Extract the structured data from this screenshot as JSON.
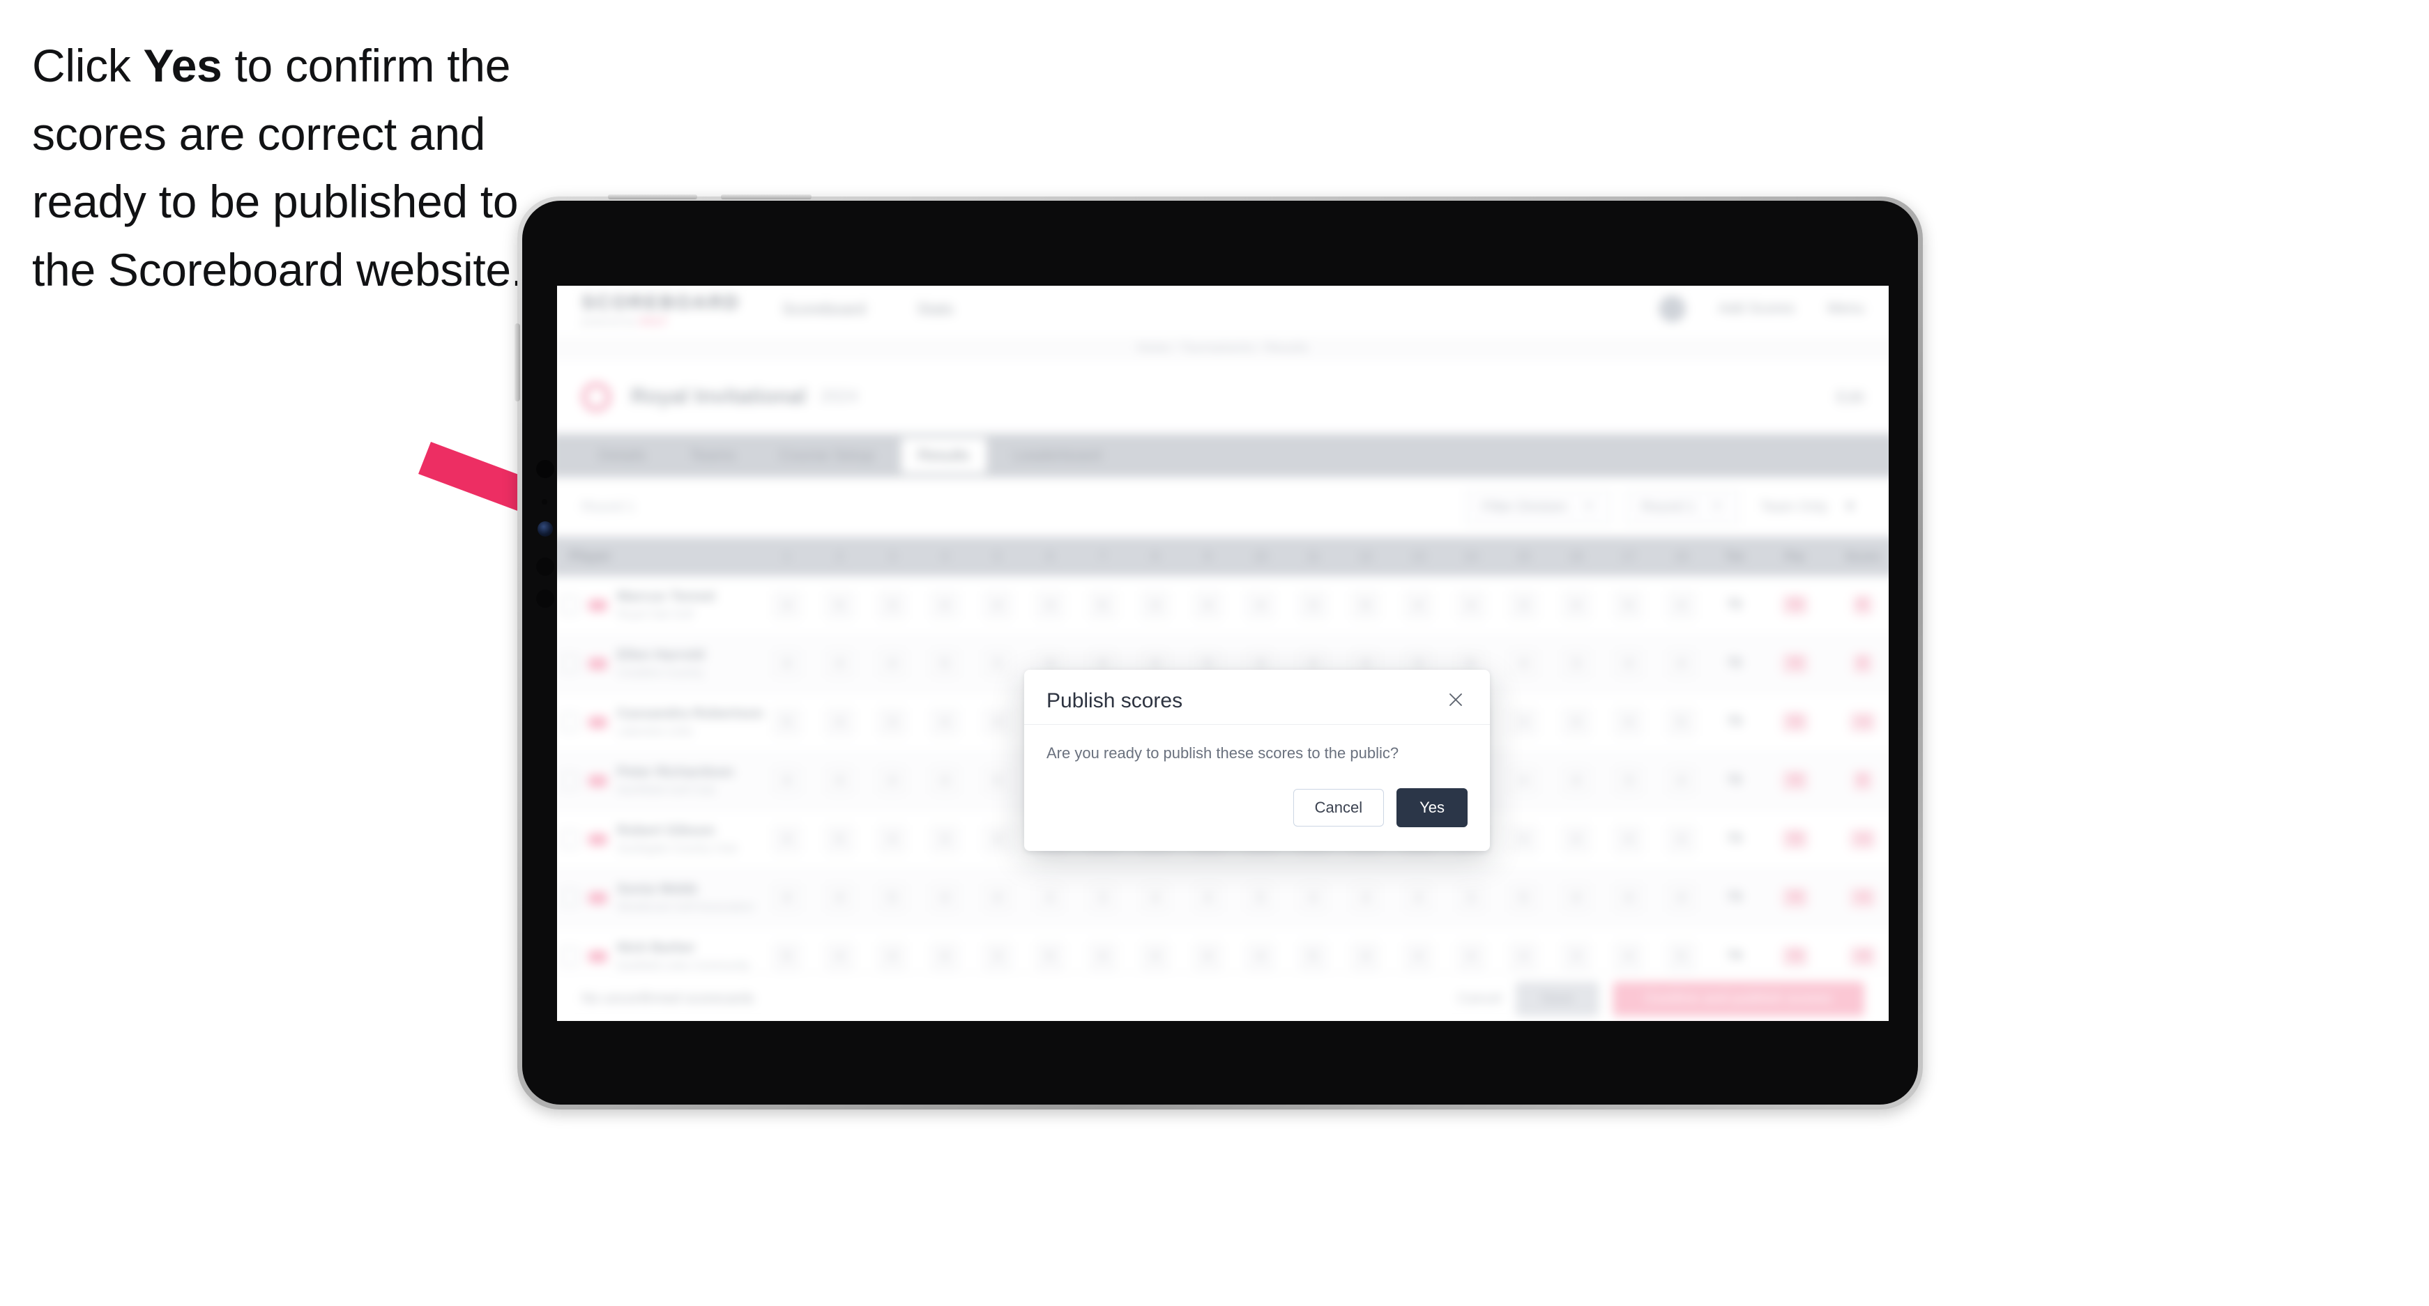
{
  "instruction": {
    "before": "Click ",
    "emphasis": "Yes",
    "after": " to confirm the scores are correct and ready to be published to the Scoreboard website."
  },
  "arrow": {
    "color": "#ED2E63",
    "name": "callout-arrow"
  },
  "device": {
    "type": "tablet",
    "orientation": "landscape",
    "frame_color": "#b9b9b9",
    "bezel_color": "#0b0b0c"
  },
  "app": {
    "topnav": {
      "logo_wordmark": "SCOREBOARD",
      "logo_tagline": "powered by",
      "logo_tagline_accent": "GOLF",
      "items": [
        {
          "label": "Scoreboard"
        },
        {
          "label": "Stats"
        }
      ],
      "right_items": [
        {
          "label": "Add Scores"
        },
        {
          "label": "Menu"
        }
      ]
    },
    "breadcrumb": "Home / Tournaments / Results",
    "title": {
      "heading": "Royal Invitational",
      "subheading": "2024",
      "right_action": "Edit"
    },
    "tabs": [
      {
        "label": "Details",
        "active": false
      },
      {
        "label": "Teams",
        "active": false
      },
      {
        "label": "Course Setup",
        "active": false
      },
      {
        "label": "Results",
        "active": true
      },
      {
        "label": "Leaderboard",
        "active": false
      }
    ],
    "filters": {
      "left_label": "Round 1",
      "controls": [
        {
          "label": "Filter Division",
          "type": "dropdown"
        },
        {
          "label": "Round 1",
          "type": "dropdown"
        },
        {
          "label": "Team Only",
          "type": "toggle"
        }
      ]
    },
    "table": {
      "columns": {
        "player": "Player",
        "holes": [
          "1",
          "2",
          "3",
          "4",
          "5",
          "6",
          "7",
          "8",
          "9",
          "10",
          "11",
          "12",
          "13",
          "14",
          "15",
          "16",
          "17",
          "18"
        ],
        "total": "Tot",
        "par": "Par",
        "score": "Score"
      },
      "rows": [
        {
          "name": "Marcus Tennet",
          "club": "Royal Oak Golf",
          "holes": [
            "4",
            "5",
            "3",
            "4",
            "4",
            "3",
            "5",
            "4",
            "4",
            "4",
            "3",
            "5",
            "4",
            "4",
            "3",
            "4",
            "5",
            "4"
          ],
          "total": "72",
          "par": "72",
          "score": "E"
        },
        {
          "name": "Ellen Harrold",
          "club": "Crestline Country",
          "holes": [
            "4",
            "4",
            "4",
            "5",
            "3",
            "4",
            "4",
            "4",
            "5",
            "4",
            "4",
            "4",
            "3",
            "5",
            "4",
            "3",
            "4",
            "4"
          ],
          "total": "72",
          "par": "72",
          "score": "E"
        },
        {
          "name": "Cassandra Robertson",
          "club": "Lakeview Links",
          "holes": [
            "5",
            "4",
            "3",
            "4",
            "4",
            "4",
            "5",
            "3",
            "4",
            "5",
            "4",
            "4",
            "4",
            "4",
            "3",
            "4",
            "4",
            "5"
          ],
          "total": "73",
          "par": "72",
          "score": "+1"
        },
        {
          "name": "Peter Richardson",
          "club": "Northfield Golf Club",
          "holes": [
            "4",
            "4",
            "4",
            "4",
            "5",
            "3",
            "4",
            "5",
            "4",
            "4",
            "3",
            "4",
            "5",
            "4",
            "4",
            "4",
            "3",
            "4"
          ],
          "total": "72",
          "par": "72",
          "score": "E"
        },
        {
          "name": "Robert Gibson",
          "club": "Southgate Country Club",
          "holes": [
            "4",
            "5",
            "4",
            "3",
            "4",
            "4",
            "4",
            "4",
            "5",
            "4",
            "4",
            "5",
            "3",
            "4",
            "4",
            "4",
            "4",
            "4"
          ],
          "total": "73",
          "par": "72",
          "score": "+1"
        },
        {
          "name": "Sonia Webb",
          "club": "Westbrook Golf Association",
          "holes": [
            "4",
            "4",
            "5",
            "4",
            "4",
            "4",
            "3",
            "4",
            "4",
            "5",
            "4",
            "4",
            "4",
            "3",
            "5",
            "4",
            "4",
            "4"
          ],
          "total": "73",
          "par": "72",
          "score": "+1"
        },
        {
          "name": "Nick Barker",
          "club": "Eastfield Links Community",
          "holes": [
            "5",
            "4",
            "4",
            "4",
            "3",
            "5",
            "4",
            "4",
            "4",
            "4",
            "5",
            "4",
            "4",
            "4",
            "4",
            "3",
            "4",
            "5"
          ],
          "total": "74",
          "par": "72",
          "score": "+2"
        }
      ]
    },
    "bottombar": {
      "status": "No unconfirmed scorecards",
      "link": "Cancel",
      "secondary_button": "Save",
      "primary_button": "Confirm and publish scores"
    }
  },
  "modal": {
    "title": "Publish scores",
    "message": "Are you ready to publish these scores to the public?",
    "close_icon": "close-icon",
    "cancel_label": "Cancel",
    "confirm_label": "Yes",
    "confirm_color": "#2b3648",
    "cancel_border_color": "#ccd6e4"
  }
}
